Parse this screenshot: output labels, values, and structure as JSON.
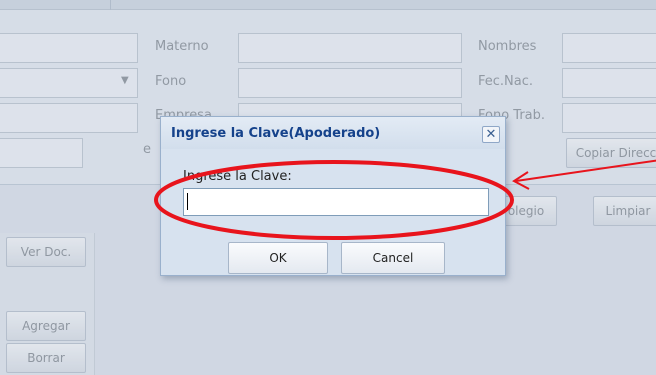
{
  "form": {
    "materno_label": "Materno",
    "nombres_label": "Nombres",
    "fono_label": "Fono",
    "fecnac_label": "Fec.Nac.",
    "empresa_label": "Empresa",
    "fonotrab_label": "Fono Trab.",
    "email_label": "e",
    "copiar_button": "Copiar Direcc",
    "colegio_button": "olegio",
    "limpiar_button": "Limpiar "
  },
  "left_panel": {
    "ver_doc_button": "Ver Doc.",
    "agregar_button": "Agregar",
    "borrar_button": "Borrar"
  },
  "dialog": {
    "title": "Ingrese la Clave(Apoderado)",
    "close_glyph": "✕",
    "prompt_label": "Ingrese la Clave:",
    "input_value": "",
    "ok_label": "OK",
    "cancel_label": "Cancel"
  },
  "annotation": {
    "ellipse_color": "#e8141c",
    "arrow_color": "#e8141c"
  }
}
